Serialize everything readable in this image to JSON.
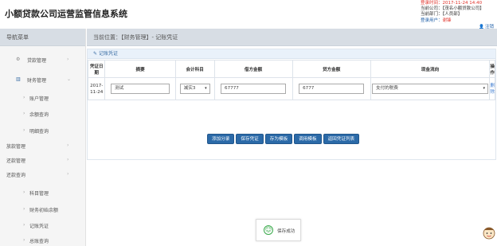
{
  "app": {
    "title": "小额贷款公司运营监管信息系统"
  },
  "userinfo": {
    "login_time": "登录时间：2017-11-24 14:40",
    "company": "当前公司：【茂名小额贷款公司】",
    "department": "当前部门：【人员部】",
    "user_label": "登录用户：",
    "user_name": "谢锋",
    "logout": "注销"
  },
  "sidebar": {
    "title": "导航菜单",
    "items": [
      {
        "label": "贷款管理",
        "icon": "gear-icon",
        "has_arrow": true,
        "level": 1
      },
      {
        "label": "财务管理",
        "icon": "bar-chart-icon",
        "has_arrow": true,
        "level": 1,
        "expanded": true
      },
      {
        "label": "账户管理",
        "level": 2
      },
      {
        "label": "余额查询",
        "level": 2
      },
      {
        "label": "明细查询",
        "level": 2
      },
      {
        "label": "放款管理",
        "level": 0,
        "has_arrow": true
      },
      {
        "label": "还款管理",
        "level": 0,
        "has_arrow": true
      },
      {
        "label": "还款查询",
        "level": 0,
        "has_arrow": true
      },
      {
        "label": "科目管理",
        "level": 2
      },
      {
        "label": "财务初始余额",
        "level": 2
      },
      {
        "label": "记账凭证",
        "level": 2
      },
      {
        "label": "总账查询",
        "level": 2
      }
    ]
  },
  "breadcrumb": "当前位置：【财务管理】- 记账凭证",
  "panel": {
    "title": "记账凭证"
  },
  "table": {
    "headers": [
      "凭证日期",
      "摘要",
      "会计科目",
      "借方金额",
      "贷方金额",
      "现金流向",
      "操作"
    ],
    "row": {
      "date": "2017-11-24",
      "summary": "测试",
      "account": "减实3",
      "debit": "67777",
      "credit": "6777",
      "cash_flow": "支付的税费",
      "action": "删除"
    }
  },
  "buttons": {
    "add_entry": "添加分录",
    "save": "保存凭证",
    "save_template": "存为模板",
    "use_template": "调用模板",
    "back_list": "返回凭证列表"
  },
  "toast": {
    "message": "保存成功"
  },
  "colors": {
    "accent": "#2b6aa8",
    "header_red": "#e0332b",
    "success": "#39a94a"
  }
}
